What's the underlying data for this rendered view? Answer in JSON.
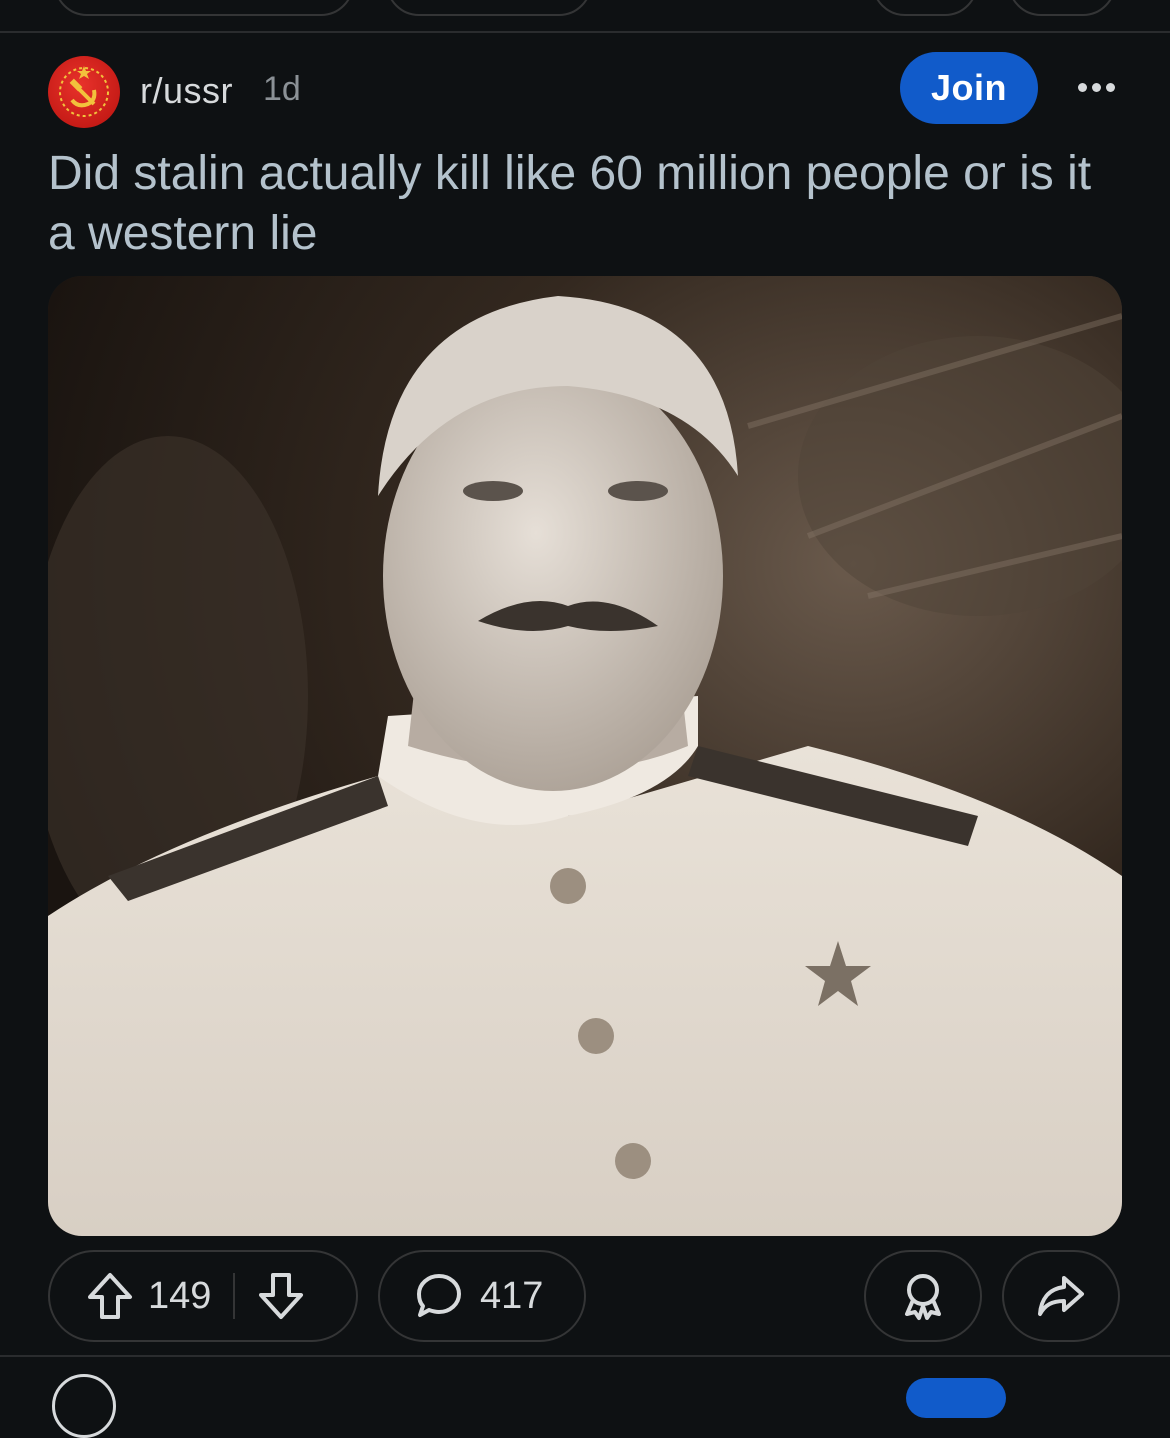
{
  "post": {
    "subreddit": "r/ussr",
    "time_ago": "1d",
    "join_label": "Join",
    "title": "Did stalin actually kill like 60 million people or is it a western lie",
    "image_alt": "Black-and-white portrait photograph",
    "upvotes": "149",
    "comments": "417"
  },
  "icons": {
    "avatar": "hammer-and-sickle-icon",
    "more": "more-horizontal-icon",
    "upvote": "upvote-arrow-icon",
    "downvote": "downvote-arrow-icon",
    "comment": "comment-bubble-icon",
    "award": "award-icon",
    "share": "share-icon"
  },
  "colors": {
    "background": "#0e1113",
    "join_button": "#115bca",
    "title_text": "#b4c2cc",
    "avatar_red": "#d31f1a"
  }
}
